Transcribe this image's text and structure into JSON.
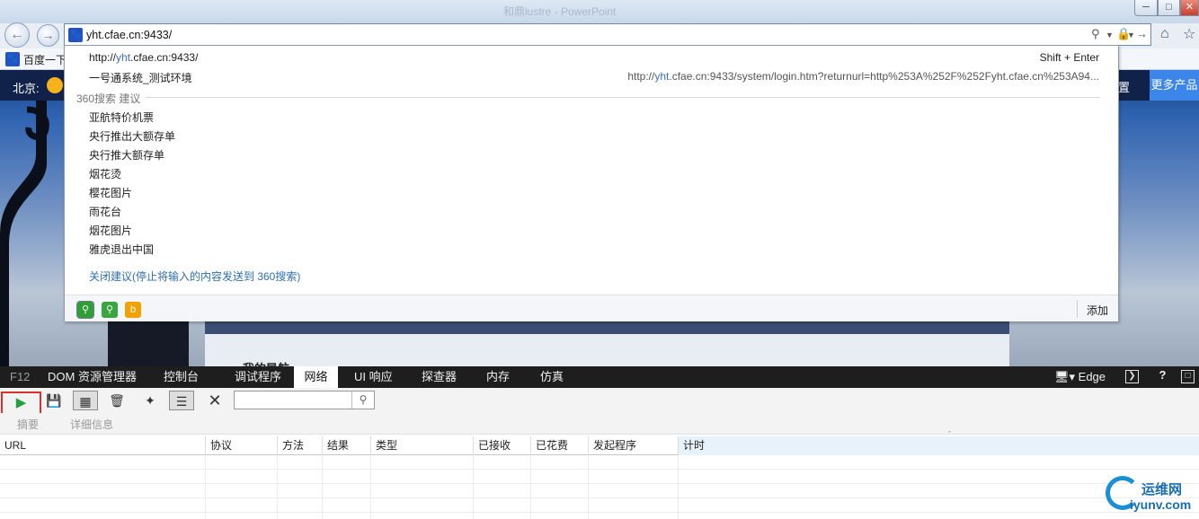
{
  "window": {
    "title_ghost": "和鼎lustre - PowerPoint",
    "min_icon": "minimize-icon",
    "max_icon": "maximize-icon",
    "close_icon": "close-icon"
  },
  "nav": {
    "back_icon": "back-arrow-icon",
    "forward_icon": "forward-arrow-icon",
    "address_value": "yht.cfae.cn:9433/",
    "home_icon": "home-icon",
    "favorites_icon": "star-icon"
  },
  "favorites_bar": {
    "item_label": "百度一下"
  },
  "page": {
    "city": "北京:",
    "settings_partial": "置",
    "more_products": "更多产品",
    "nav_heading_partial": "我的导航"
  },
  "suggestions": {
    "url_prefix": "http://",
    "url_highlight": "yht",
    "url_suffix": ".cfae.cn:9433/",
    "shortcut": "Shift + Enter",
    "history_title": "一号通系统_测试环境",
    "history_url_prefix": "http://",
    "history_url_highlight": "yht",
    "history_url_suffix": ".cfae.cn:9433/system/login.htm?returnurl=http%253A%252F%252Fyht.cfae.cn%253A94...",
    "section_title": "360搜索 建议",
    "items": [
      "亚航特价机票",
      "央行推出大额存单",
      "央行推大额存单",
      "烟花烫",
      "樱花图片",
      "雨花台",
      "烟花图片",
      "雅虎退出中国"
    ],
    "close_link": "关闭建议(停止将输入的内容发送到 360搜索)",
    "add_label": "添加"
  },
  "devtools": {
    "tabs": [
      {
        "label": "F12"
      },
      {
        "label": "DOM 资源管理器"
      },
      {
        "label": "控制台"
      },
      {
        "label": "调试程序"
      },
      {
        "label": "网络"
      },
      {
        "label": "UI 响应"
      },
      {
        "label": "探查器"
      },
      {
        "label": "内存"
      },
      {
        "label": "仿真"
      }
    ],
    "active_tab": "网络",
    "engine": "Edge",
    "help": "?",
    "subtabs": [
      "摘要",
      "详细信息"
    ],
    "search_value": "",
    "columns": [
      "URL",
      "协议",
      "方法",
      "结果",
      "类型",
      "已接收",
      "已花费",
      "发起程序",
      "计时"
    ]
  },
  "watermark": {
    "cn": "运维网",
    "en": "iyunv.com"
  }
}
